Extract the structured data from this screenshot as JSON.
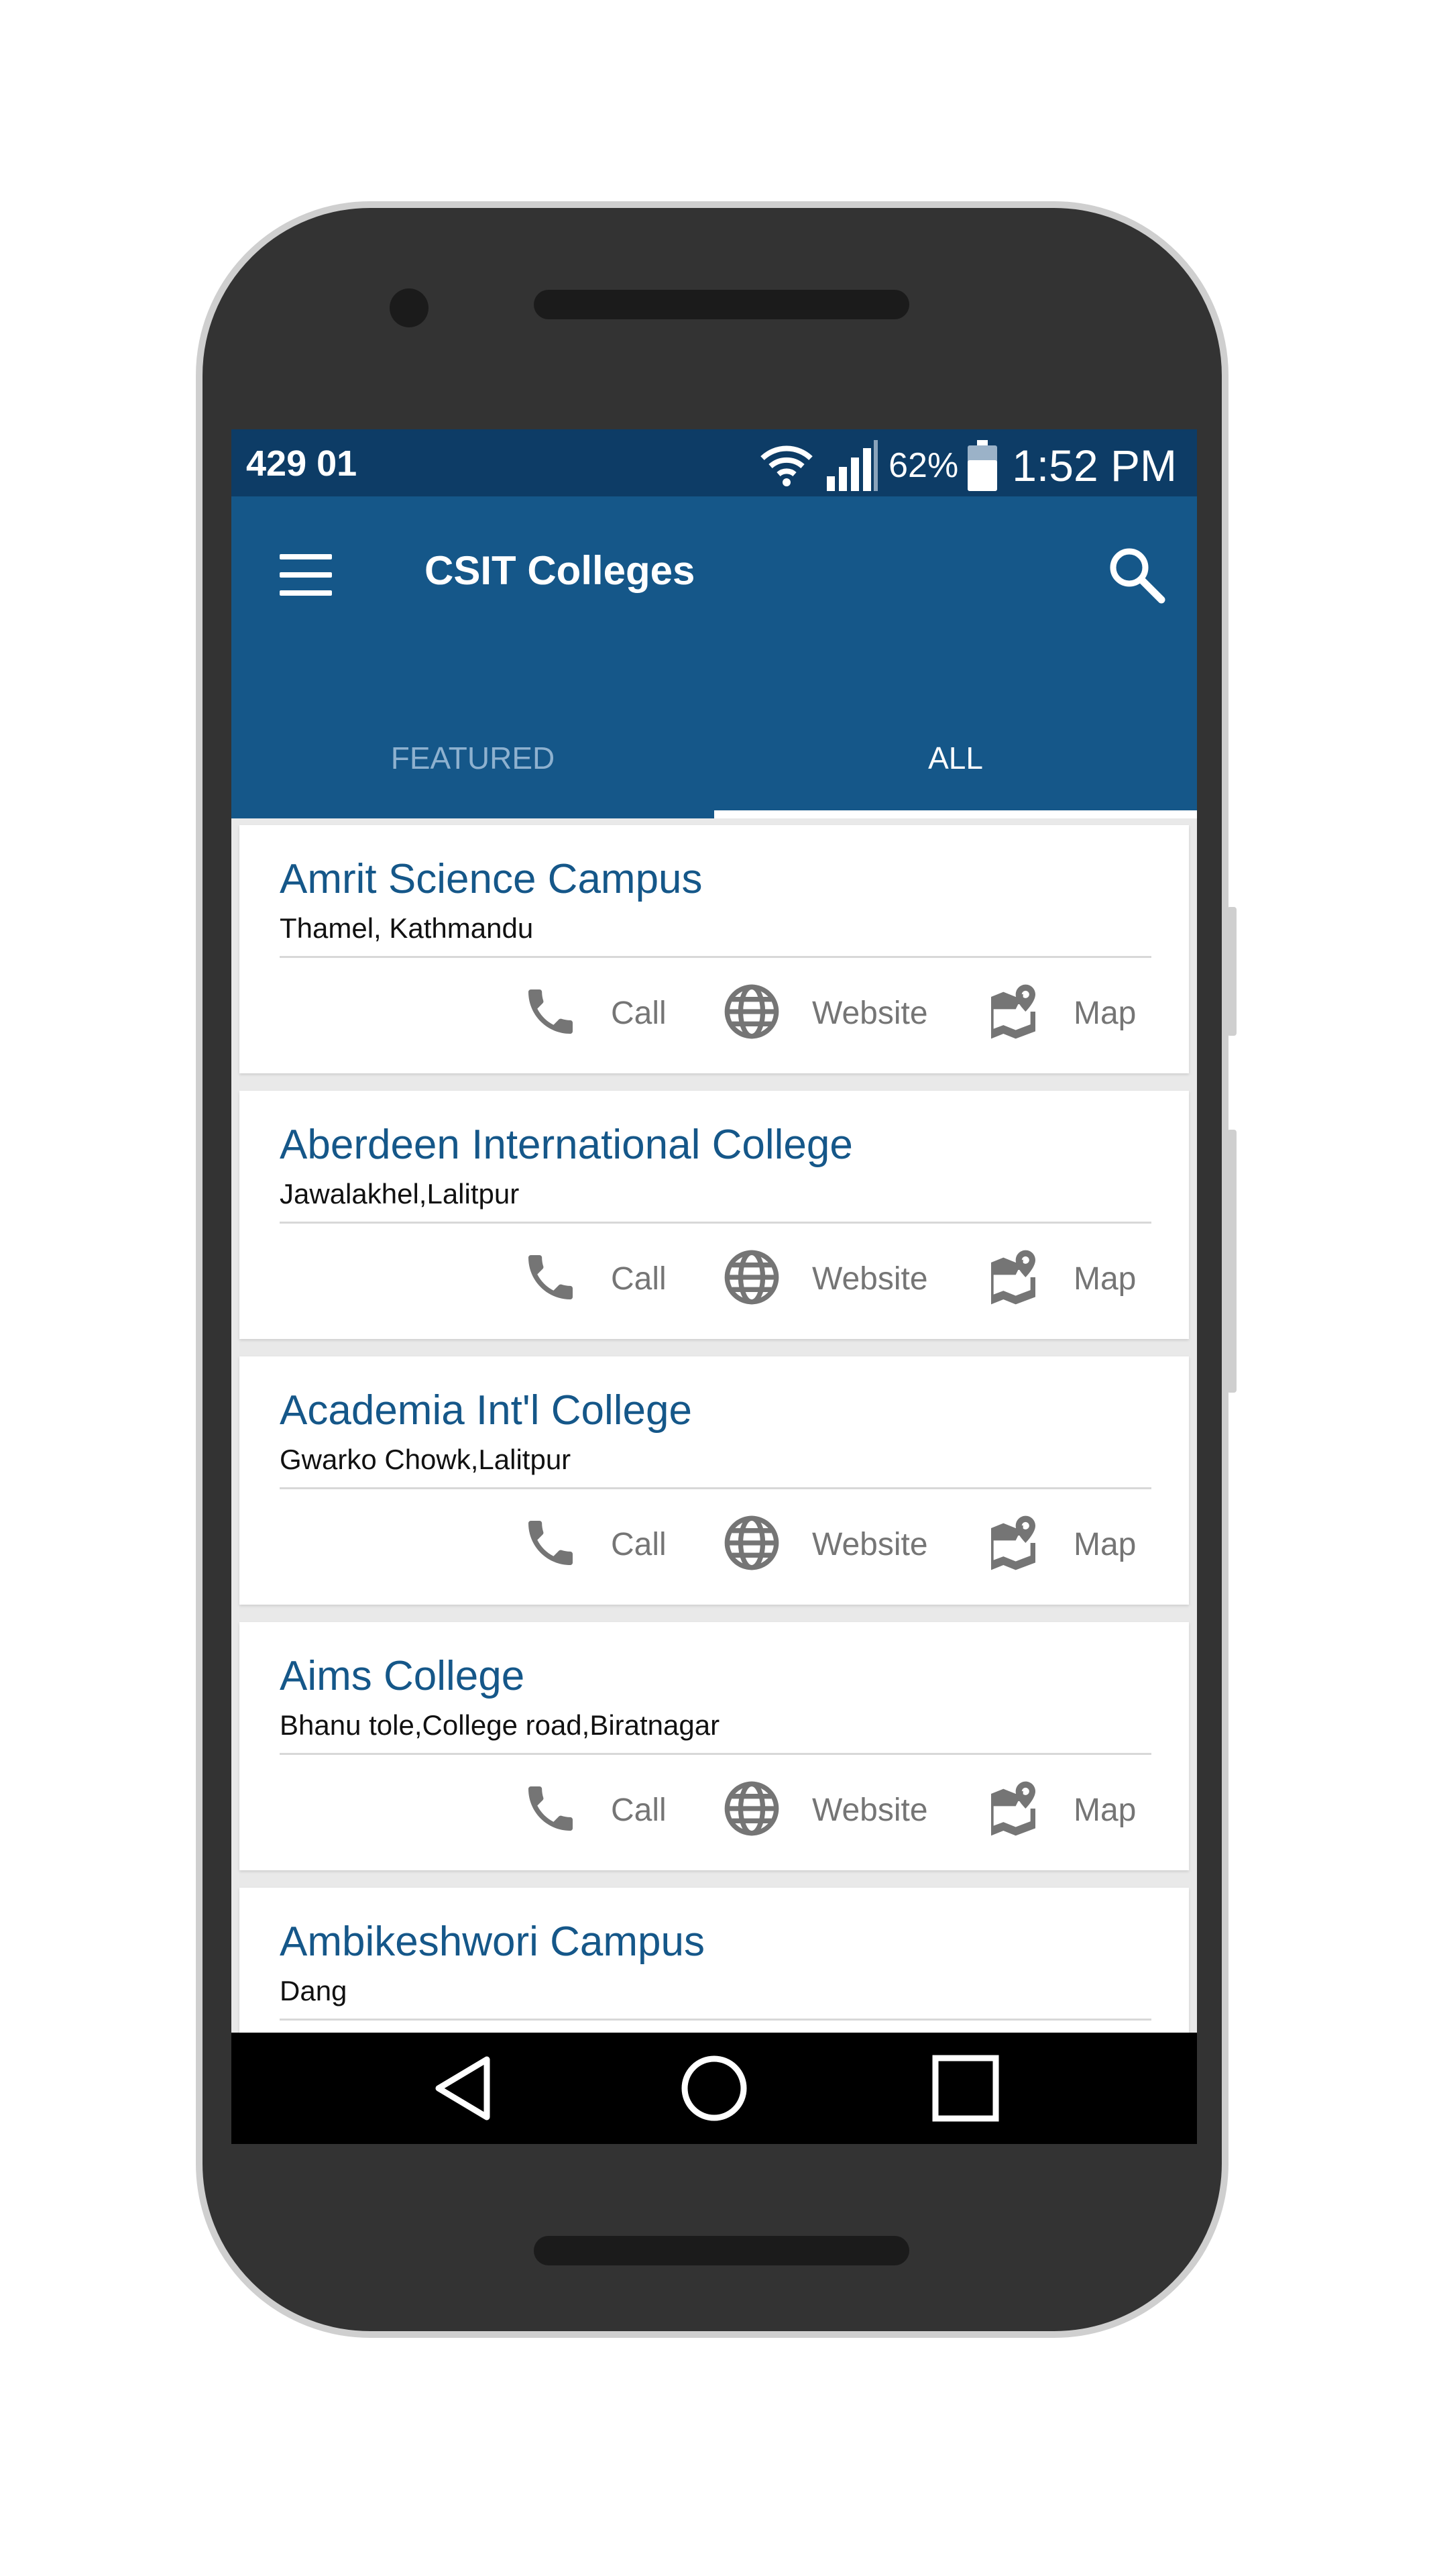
{
  "status_bar": {
    "carrier": "429 01",
    "battery_percent": "62%",
    "time": "1:52 PM"
  },
  "app_bar": {
    "title": "CSIT Colleges",
    "menu_icon": "menu-icon",
    "search_icon": "search-icon"
  },
  "tabs": [
    {
      "label": "FEATURED",
      "selected": false
    },
    {
      "label": "ALL",
      "selected": true
    }
  ],
  "colleges": [
    {
      "name": "Amrit Science Campus",
      "address": "Thamel, Kathmandu"
    },
    {
      "name": "Aberdeen International College",
      "address": "Jawalakhel,Lalitpur"
    },
    {
      "name": "Academia Int'l College",
      "address": "Gwarko Chowk,Lalitpur"
    },
    {
      "name": "Aims College",
      "address": "Bhanu tole,College road,Biratnagar"
    },
    {
      "name": "Ambikeshwori Campus",
      "address": "Dang"
    }
  ],
  "actions": {
    "call": "Call",
    "website": "Website",
    "map": "Map"
  },
  "colors": {
    "primary": "#155789",
    "status_bar": "#0d3c66",
    "action_gray": "#757575"
  }
}
